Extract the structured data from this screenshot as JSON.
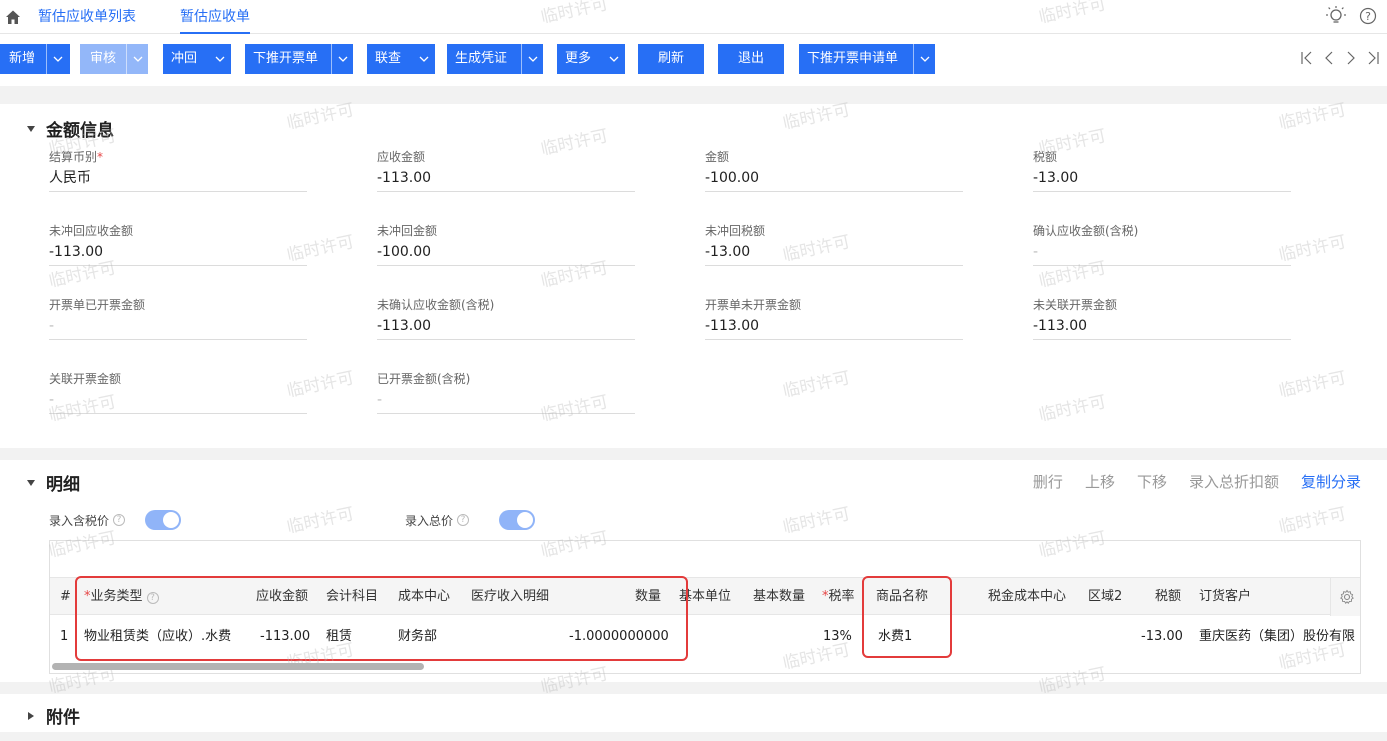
{
  "tabs": {
    "list": "暂估应收单列表",
    "current": "暂估应收单"
  },
  "toolbar": {
    "add": "新增",
    "audit": "审核",
    "reverse": "冲回",
    "push_invoice": "下推开票单",
    "query": "联查",
    "voucher": "生成凭证",
    "more": "更多",
    "refresh": "刷新",
    "exit": "退出",
    "push_invoice_apply": "下推开票申请单"
  },
  "amount_section": {
    "title": "金额信息",
    "fields": [
      {
        "label": "结算币别",
        "required": true,
        "value": "人民币"
      },
      {
        "label": "应收金额",
        "value": "-113.00"
      },
      {
        "label": "金额",
        "value": "-100.00"
      },
      {
        "label": "税额",
        "value": "-13.00"
      },
      {
        "label": "未冲回应收金额",
        "value": "-113.00"
      },
      {
        "label": "未冲回金额",
        "value": "-100.00"
      },
      {
        "label": "未冲回税额",
        "value": "-13.00"
      },
      {
        "label": "确认应收金额(含税)",
        "value": "-"
      },
      {
        "label": "开票单已开票金额",
        "value": "-"
      },
      {
        "label": "未确认应收金额(含税)",
        "value": "-113.00"
      },
      {
        "label": "开票单未开票金额",
        "value": "-113.00"
      },
      {
        "label": "未关联开票金额",
        "value": "-113.00"
      },
      {
        "label": "关联开票金额",
        "value": "-"
      },
      {
        "label": "已开票金额(含税)",
        "value": "-"
      }
    ]
  },
  "detail_section": {
    "title": "明细",
    "actions": [
      "删行",
      "上移",
      "下移",
      "录入总折扣额",
      "复制分录"
    ],
    "toggle_tax_price": "录入含税价",
    "toggle_total_price": "录入总价",
    "columns": {
      "idx": "#",
      "biz_type": "业务类型",
      "receivable": "应收金额",
      "account": "会计科目",
      "cost_center": "成本中心",
      "medical": "医疗收入明细",
      "qty": "数量",
      "unit": "基本单位",
      "base_qty": "基本数量",
      "tax_rate": "税率",
      "goods_name": "商品名称",
      "tax_cost_center": "税金成本中心",
      "region2": "区域2",
      "tax_amount": "税额",
      "customer": "订货客户"
    },
    "row": {
      "idx": "1",
      "biz_type": "物业租赁类（应收）.水费",
      "receivable": "-113.00",
      "account": "租赁",
      "cost_center": "财务部",
      "qty": "-1.0000000000",
      "tax_rate": "13%",
      "goods_name": "水费1",
      "tax_amount": "-13.00",
      "customer": "重庆医药（集团）股份有限"
    }
  },
  "attachment_section": {
    "title": "附件"
  },
  "watermark": "临时许可"
}
